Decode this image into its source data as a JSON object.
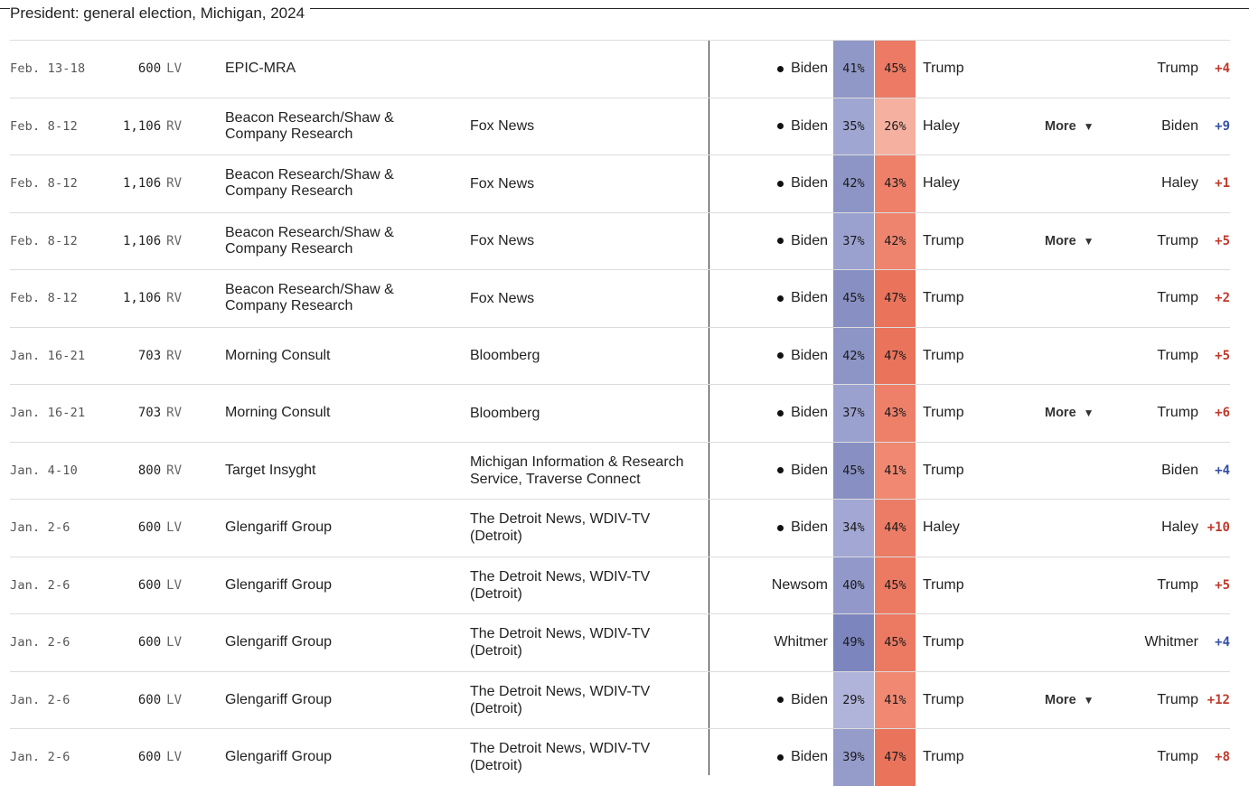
{
  "title": "President: general election, Michigan, 2024",
  "more_label": "More",
  "colors": {
    "dem": "#3550a6",
    "rep": "#c0392b"
  },
  "rows": [
    {
      "dates": "Feb. 13-18",
      "sample": "600",
      "pop": "LV",
      "pollster": "EPIC-MRA",
      "sponsor": "",
      "cand1": "Biden",
      "dot": true,
      "pct1": "41%",
      "pct2": "45%",
      "cand2": "Trump",
      "more": false,
      "leader": "Trump",
      "margin": "+4",
      "lean": "rep",
      "bg1": "#9098c8",
      "bg2": "#ec7a64"
    },
    {
      "dates": "Feb. 8-12",
      "sample": "1,106",
      "pop": "RV",
      "pollster": "Beacon Research/Shaw & Company Research",
      "sponsor": "Fox News",
      "cand1": "Biden",
      "dot": true,
      "pct1": "35%",
      "pct2": "26%",
      "cand2": "Haley",
      "more": true,
      "leader": "Biden",
      "margin": "+9",
      "lean": "dem",
      "bg1": "#a0a6d2",
      "bg2": "#f5b0a0"
    },
    {
      "dates": "Feb. 8-12",
      "sample": "1,106",
      "pop": "RV",
      "pollster": "Beacon Research/Shaw & Company Research",
      "sponsor": "Fox News",
      "cand1": "Biden",
      "dot": true,
      "pct1": "42%",
      "pct2": "43%",
      "cand2": "Haley",
      "more": false,
      "leader": "Haley",
      "margin": "+1",
      "lean": "rep",
      "bg1": "#8d95c6",
      "bg2": "#ee806a"
    },
    {
      "dates": "Feb. 8-12",
      "sample": "1,106",
      "pop": "RV",
      "pollster": "Beacon Research/Shaw & Company Research",
      "sponsor": "Fox News",
      "cand1": "Biden",
      "dot": true,
      "pct1": "37%",
      "pct2": "42%",
      "cand2": "Trump",
      "more": true,
      "leader": "Trump",
      "margin": "+5",
      "lean": "rep",
      "bg1": "#9ba1cf",
      "bg2": "#ef846e"
    },
    {
      "dates": "Feb. 8-12",
      "sample": "1,106",
      "pop": "RV",
      "pollster": "Beacon Research/Shaw & Company Research",
      "sponsor": "Fox News",
      "cand1": "Biden",
      "dot": true,
      "pct1": "45%",
      "pct2": "47%",
      "cand2": "Trump",
      "more": false,
      "leader": "Trump",
      "margin": "+2",
      "lean": "rep",
      "bg1": "#8890c3",
      "bg2": "#ea735c"
    },
    {
      "dates": "Jan. 16-21",
      "sample": "703",
      "pop": "RV",
      "pollster": "Morning Consult",
      "sponsor": "Bloomberg",
      "cand1": "Biden",
      "dot": true,
      "pct1": "42%",
      "pct2": "47%",
      "cand2": "Trump",
      "more": false,
      "leader": "Trump",
      "margin": "+5",
      "lean": "rep",
      "bg1": "#8d95c6",
      "bg2": "#ea735c"
    },
    {
      "dates": "Jan. 16-21",
      "sample": "703",
      "pop": "RV",
      "pollster": "Morning Consult",
      "sponsor": "Bloomberg",
      "cand1": "Biden",
      "dot": true,
      "pct1": "37%",
      "pct2": "43%",
      "cand2": "Trump",
      "more": true,
      "leader": "Trump",
      "margin": "+6",
      "lean": "rep",
      "bg1": "#9ba1cf",
      "bg2": "#ee806a"
    },
    {
      "dates": "Jan. 4-10",
      "sample": "800",
      "pop": "RV",
      "pollster": "Target Insyght",
      "sponsor": "Michigan Information & Research Service, Traverse Connect",
      "cand1": "Biden",
      "dot": true,
      "pct1": "45%",
      "pct2": "41%",
      "cand2": "Trump",
      "more": false,
      "leader": "Biden",
      "margin": "+4",
      "lean": "dem",
      "bg1": "#8890c3",
      "bg2": "#f08872"
    },
    {
      "dates": "Jan. 2-6",
      "sample": "600",
      "pop": "LV",
      "pollster": "Glengariff Group",
      "sponsor": "The Detroit News, WDIV-TV (Detroit)",
      "cand1": "Biden",
      "dot": true,
      "pct1": "34%",
      "pct2": "44%",
      "cand2": "Haley",
      "more": false,
      "leader": "Haley",
      "margin": "+10",
      "lean": "rep",
      "bg1": "#a2a8d3",
      "bg2": "#ed7c66"
    },
    {
      "dates": "Jan. 2-6",
      "sample": "600",
      "pop": "LV",
      "pollster": "Glengariff Group",
      "sponsor": "The Detroit News, WDIV-TV (Detroit)",
      "cand1": "Newsom",
      "dot": false,
      "pct1": "40%",
      "pct2": "45%",
      "cand2": "Trump",
      "more": false,
      "leader": "Trump",
      "margin": "+5",
      "lean": "rep",
      "bg1": "#9299ca",
      "bg2": "#ec7962"
    },
    {
      "dates": "Jan. 2-6",
      "sample": "600",
      "pop": "LV",
      "pollster": "Glengariff Group",
      "sponsor": "The Detroit News, WDIV-TV (Detroit)",
      "cand1": "Whitmer",
      "dot": false,
      "pct1": "49%",
      "pct2": "45%",
      "cand2": "Trump",
      "more": false,
      "leader": "Whitmer",
      "margin": "+4",
      "lean": "dem",
      "bg1": "#7c85be",
      "bg2": "#ec7962"
    },
    {
      "dates": "Jan. 2-6",
      "sample": "600",
      "pop": "LV",
      "pollster": "Glengariff Group",
      "sponsor": "The Detroit News, WDIV-TV (Detroit)",
      "cand1": "Biden",
      "dot": true,
      "pct1": "29%",
      "pct2": "41%",
      "cand2": "Trump",
      "more": true,
      "leader": "Trump",
      "margin": "+12",
      "lean": "rep",
      "bg1": "#b0b4da",
      "bg2": "#f08872"
    },
    {
      "dates": "Jan. 2-6",
      "sample": "600",
      "pop": "LV",
      "pollster": "Glengariff Group",
      "sponsor": "The Detroit News, WDIV-TV (Detroit)",
      "cand1": "Biden",
      "dot": true,
      "pct1": "39%",
      "pct2": "47%",
      "cand2": "Trump",
      "more": false,
      "leader": "Trump",
      "margin": "+8",
      "lean": "rep",
      "bg1": "#959cca",
      "bg2": "#ea735c"
    }
  ]
}
